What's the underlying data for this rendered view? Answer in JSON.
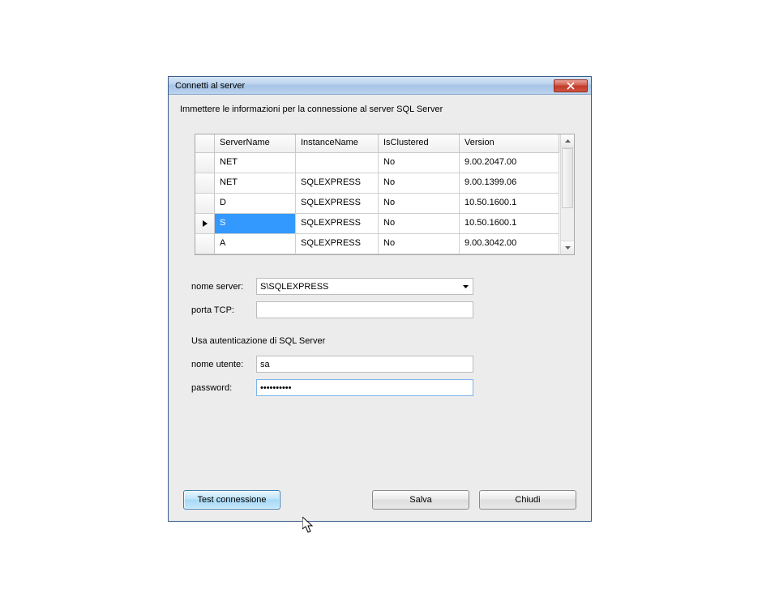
{
  "titlebar": {
    "title": "Connetti al server"
  },
  "instruction": "Immettere le informazioni per la connessione al server SQL Server",
  "grid": {
    "headers": {
      "server": "ServerName",
      "instance": "InstanceName",
      "clustered": "IsClustered",
      "version": "Version"
    },
    "rows": [
      {
        "server": "NET",
        "instance": "",
        "clustered": "No",
        "version": "9.00.2047.00",
        "selected": false
      },
      {
        "server": "NET",
        "instance": "SQLEXPRESS",
        "clustered": "No",
        "version": "9.00.1399.06",
        "selected": false
      },
      {
        "server": "D",
        "instance": "SQLEXPRESS",
        "clustered": "No",
        "version": "10.50.1600.1",
        "selected": false
      },
      {
        "server": "S",
        "instance": "SQLEXPRESS",
        "clustered": "No",
        "version": "10.50.1600.1",
        "selected": true
      },
      {
        "server": "A",
        "instance": "SQLEXPRESS",
        "clustered": "No",
        "version": "9.00.3042.00",
        "selected": false
      }
    ]
  },
  "form": {
    "server_label": "nome server:",
    "server_value": "S\\SQLEXPRESS",
    "port_label": "porta TCP:",
    "port_value": "",
    "auth_label": "Usa autenticazione di SQL Server",
    "user_label": "nome utente:",
    "user_value": "sa",
    "pass_label": "password:",
    "pass_value": "••••••••••"
  },
  "buttons": {
    "test": "Test connessione",
    "save": "Salva",
    "close": "Chiudi"
  }
}
